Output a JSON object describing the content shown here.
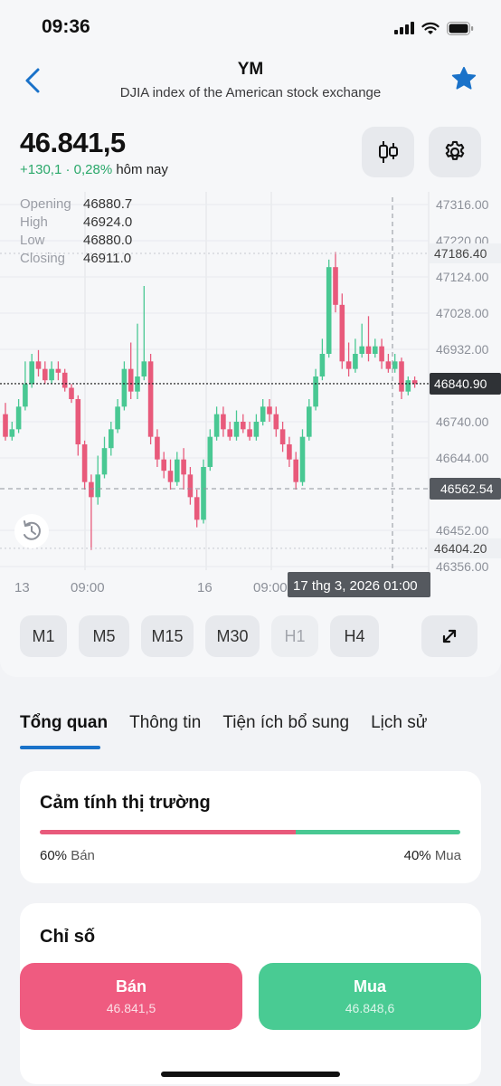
{
  "status": {
    "time": "09:36"
  },
  "header": {
    "title": "YM",
    "subtitle": "DJIA index of the American stock exchange"
  },
  "quote": {
    "price": "46.841,5",
    "change": "+130,1 · 0,28%",
    "change_suffix": "hôm nay"
  },
  "ohlc": [
    {
      "label": "Opening",
      "value": "46880.7"
    },
    {
      "label": "High",
      "value": "46924.0"
    },
    {
      "label": "Low",
      "value": "46880.0"
    },
    {
      "label": "Closing",
      "value": "46911.0"
    }
  ],
  "chart_data": {
    "type": "candlestick",
    "y_ticks": [
      "47316.00",
      "47220.00",
      "47124.00",
      "47028.00",
      "46932.00",
      "46740.00",
      "46644.00",
      "46452.00",
      "46356.00"
    ],
    "ylim": [
      46356,
      47316
    ],
    "x_ticks": [
      "13",
      "09:00",
      "16",
      "09:00"
    ],
    "last_price": "46840.90",
    "marker_high": "47186.40",
    "marker_low": "46404.20",
    "crosshair_price": "46562.54",
    "crosshair_time": "17 thg 3, 2026 01:00",
    "candles": [
      [
        46760,
        46700,
        46790,
        46690
      ],
      [
        46700,
        46720,
        46740,
        46690
      ],
      [
        46720,
        46780,
        46800,
        46710
      ],
      [
        46780,
        46840,
        46900,
        46770
      ],
      [
        46840,
        46900,
        46920,
        46830
      ],
      [
        46900,
        46880,
        46930,
        46860
      ],
      [
        46880,
        46850,
        46900,
        46840
      ],
      [
        46850,
        46880,
        46900,
        46840
      ],
      [
        46880,
        46870,
        46900,
        46850
      ],
      [
        46870,
        46830,
        46880,
        46820
      ],
      [
        46830,
        46800,
        46840,
        46790
      ],
      [
        46800,
        46680,
        46810,
        46650
      ],
      [
        46680,
        46580,
        46690,
        46560
      ],
      [
        46580,
        46540,
        46600,
        46400
      ],
      [
        46540,
        46600,
        46650,
        46520
      ],
      [
        46600,
        46670,
        46700,
        46590
      ],
      [
        46670,
        46720,
        46740,
        46650
      ],
      [
        46720,
        46780,
        46800,
        46710
      ],
      [
        46780,
        46880,
        46900,
        46770
      ],
      [
        46880,
        46820,
        46950,
        46800
      ],
      [
        46820,
        46860,
        47000,
        46800
      ],
      [
        46860,
        46900,
        47100,
        46850
      ],
      [
        46900,
        46700,
        46920,
        46680
      ],
      [
        46700,
        46640,
        46720,
        46620
      ],
      [
        46640,
        46610,
        46660,
        46590
      ],
      [
        46610,
        46580,
        46640,
        46560
      ],
      [
        46580,
        46640,
        46660,
        46570
      ],
      [
        46640,
        46600,
        46670,
        46560
      ],
      [
        46600,
        46540,
        46620,
        46520
      ],
      [
        46540,
        46480,
        46560,
        46460
      ],
      [
        46480,
        46620,
        46640,
        46470
      ],
      [
        46620,
        46700,
        46720,
        46610
      ],
      [
        46700,
        46760,
        46780,
        46690
      ],
      [
        46760,
        46720,
        46780,
        46700
      ],
      [
        46720,
        46700,
        46740,
        46690
      ],
      [
        46700,
        46740,
        46770,
        46690
      ],
      [
        46740,
        46720,
        46760,
        46710
      ],
      [
        46720,
        46700,
        46740,
        46690
      ],
      [
        46700,
        46740,
        46760,
        46690
      ],
      [
        46740,
        46780,
        46800,
        46730
      ],
      [
        46780,
        46760,
        46800,
        46740
      ],
      [
        46760,
        46720,
        46780,
        46700
      ],
      [
        46720,
        46680,
        46740,
        46660
      ],
      [
        46680,
        46640,
        46700,
        46620
      ],
      [
        46640,
        46580,
        46660,
        46560
      ],
      [
        46580,
        46700,
        46720,
        46570
      ],
      [
        46700,
        46780,
        46800,
        46690
      ],
      [
        46780,
        46860,
        46880,
        46770
      ],
      [
        46860,
        46920,
        46960,
        46850
      ],
      [
        46920,
        47150,
        47170,
        46910
      ],
      [
        47150,
        47050,
        47190,
        47030
      ],
      [
        47050,
        46900,
        47080,
        46880
      ],
      [
        46900,
        46880,
        46950,
        46860
      ],
      [
        46880,
        46920,
        46960,
        46870
      ],
      [
        46920,
        46940,
        47000,
        46910
      ],
      [
        46940,
        46920,
        47020,
        46900
      ],
      [
        46920,
        46940,
        46960,
        46910
      ],
      [
        46940,
        46900,
        46960,
        46880
      ],
      [
        46900,
        46880,
        46920,
        46870
      ],
      [
        46880,
        46900,
        46920,
        46870
      ],
      [
        46900,
        46820,
        46910,
        46800
      ],
      [
        46820,
        46850,
        46860,
        46810
      ],
      [
        46850,
        46840,
        46860,
        46830
      ]
    ]
  },
  "timeframes": [
    {
      "label": "M1",
      "enabled": true
    },
    {
      "label": "M5",
      "enabled": true
    },
    {
      "label": "M15",
      "enabled": true
    },
    {
      "label": "M30",
      "enabled": true
    },
    {
      "label": "H1",
      "enabled": false
    },
    {
      "label": "H4",
      "enabled": true
    }
  ],
  "tabs": [
    "Tổng quan",
    "Thông tin",
    "Tiện ích bổ sung",
    "Lịch sử"
  ],
  "sentiment": {
    "title": "Cảm tính thị trường",
    "sell_pct": "60%",
    "sell_label": "Bán",
    "buy_pct": "40%",
    "buy_label": "Mua",
    "sell_fraction": 0.6
  },
  "index_card": {
    "title": "Chỉ số"
  },
  "actions": {
    "sell_label": "Bán",
    "sell_price": "46.841,5",
    "buy_label": "Mua",
    "buy_price": "46.848,6"
  },
  "colors": {
    "accent": "#1a72c9",
    "up": "#49c893",
    "down": "#e85a7b"
  }
}
